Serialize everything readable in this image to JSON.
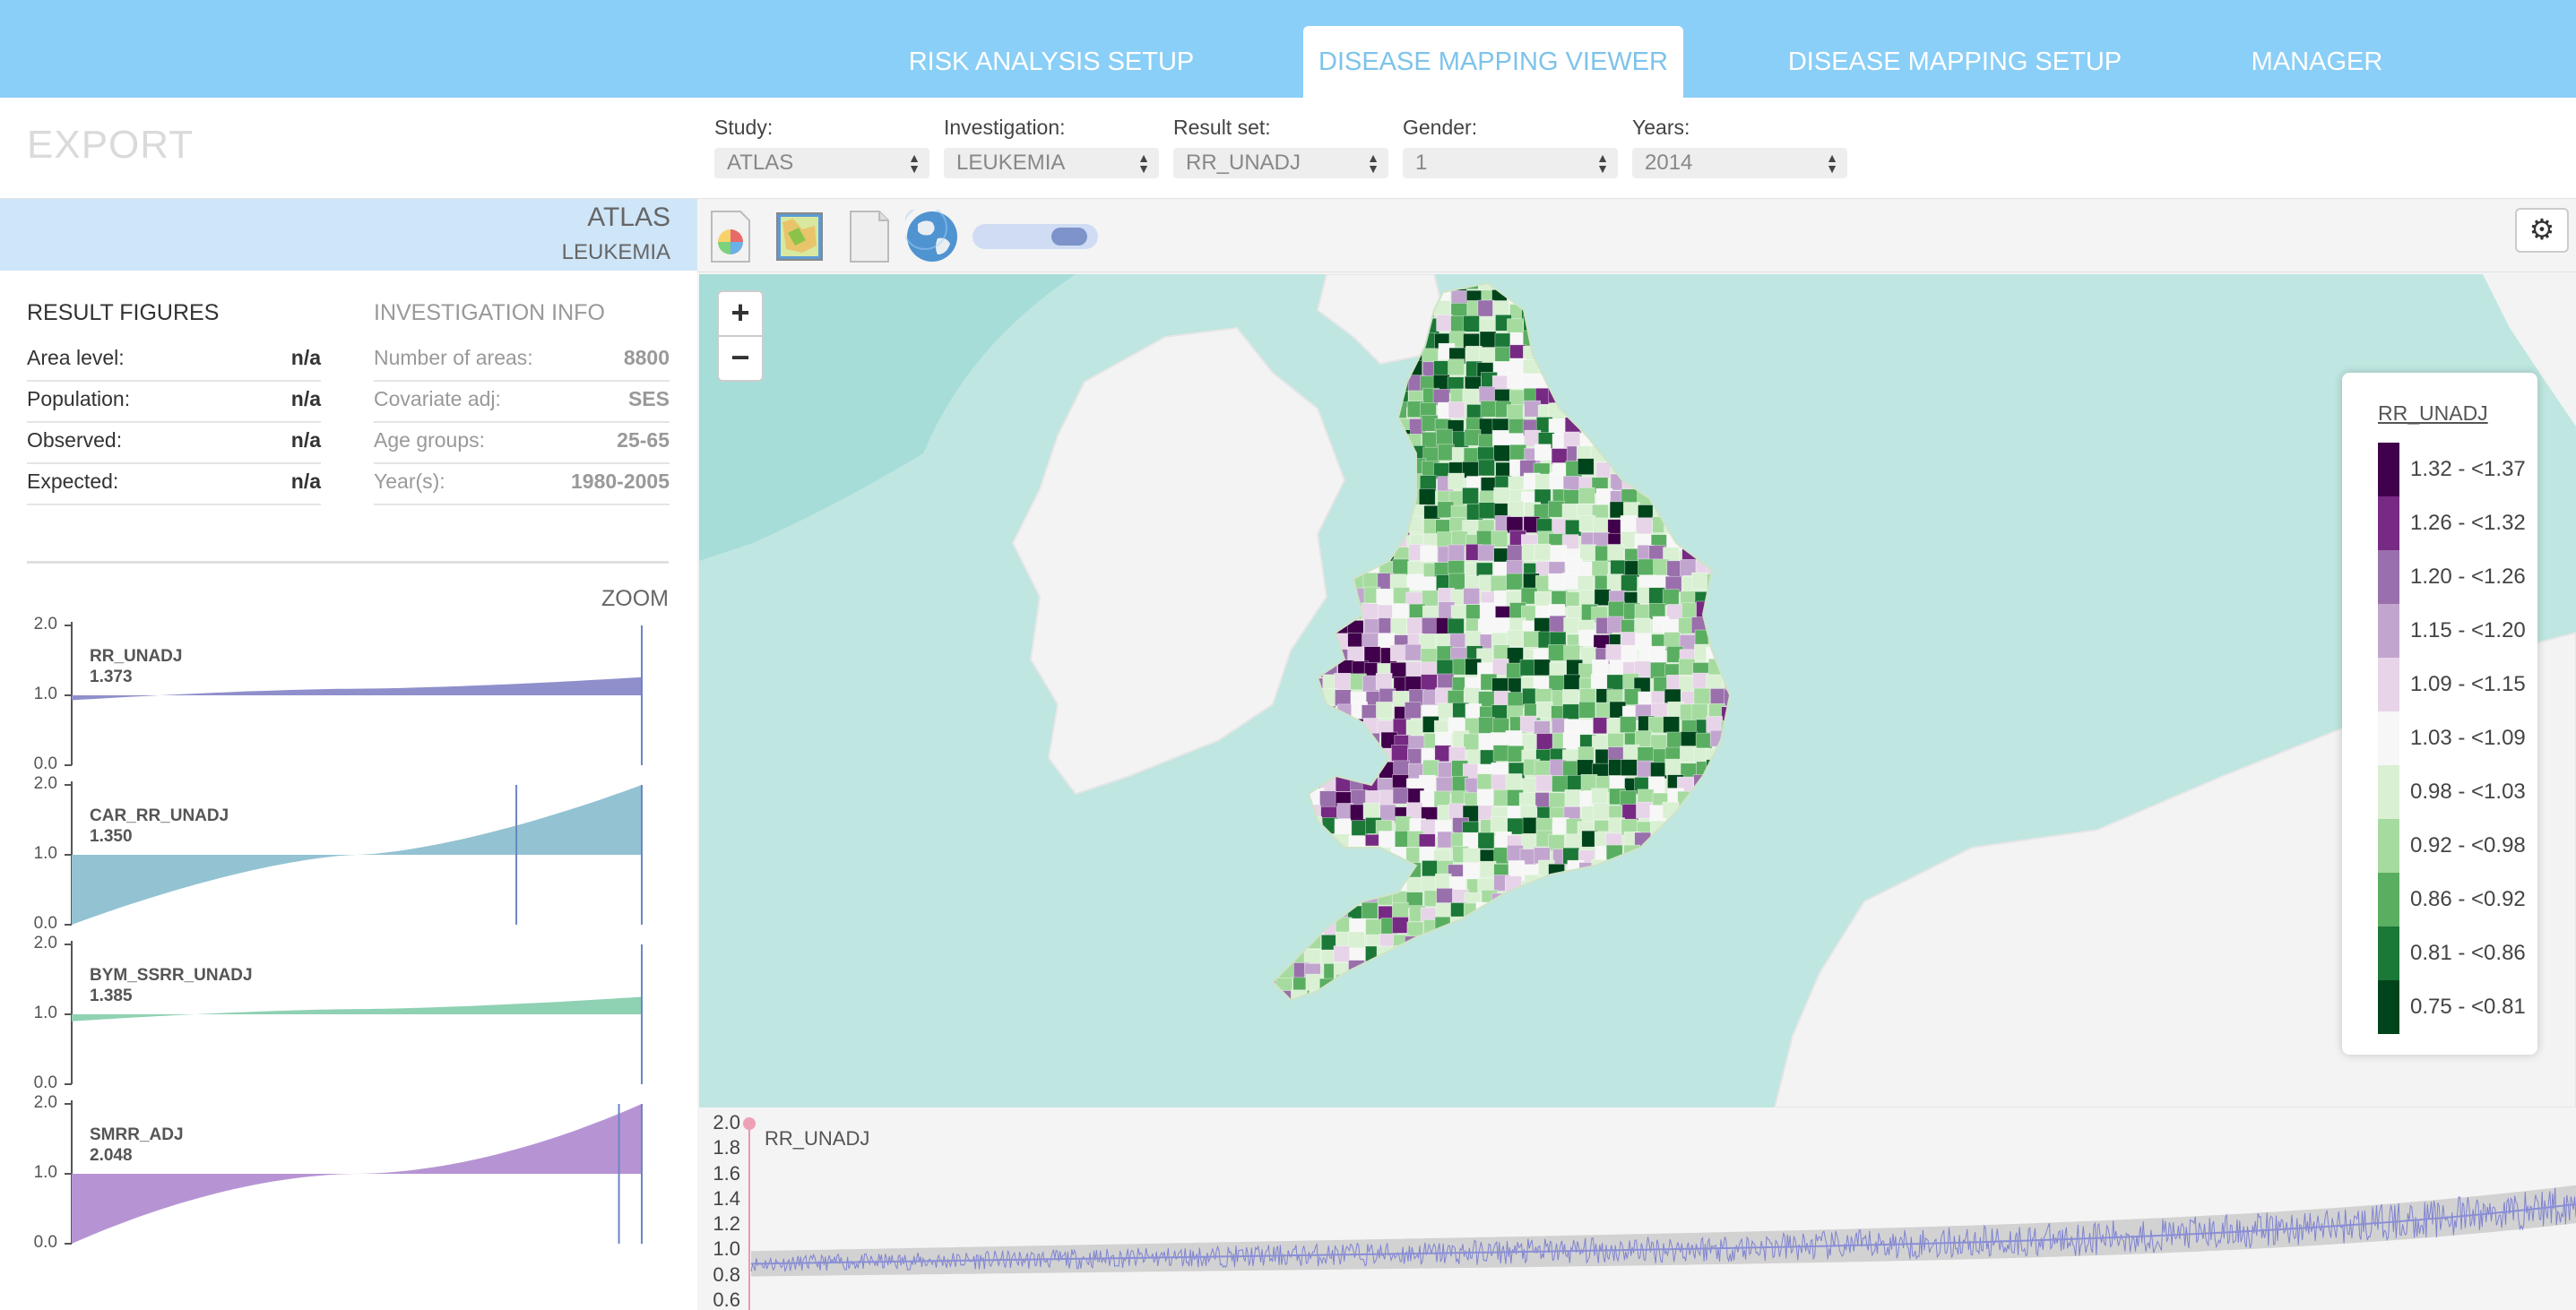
{
  "nav": {
    "tabs": [
      {
        "label": "RISK ANALYSIS SETUP",
        "active": false
      },
      {
        "label": "DISEASE MAPPING VIEWER",
        "active": true
      },
      {
        "label": "DISEASE MAPPING SETUP",
        "active": false
      },
      {
        "label": "MANAGER",
        "active": false
      }
    ]
  },
  "header": {
    "export_label": "EXPORT",
    "fields": [
      {
        "label": "Study:",
        "value": "ATLAS"
      },
      {
        "label": "Investigation:",
        "value": "LEUKEMIA"
      },
      {
        "label": "Result set:",
        "value": "RR_UNADJ"
      },
      {
        "label": "Gender:",
        "value": "1"
      },
      {
        "label": "Years:",
        "value": "2014"
      }
    ]
  },
  "banner": {
    "study": "ATLAS",
    "investigation": "LEUKEMIA"
  },
  "result_figures": {
    "title": "RESULT FIGURES",
    "rows": [
      {
        "key": "Area level:",
        "value": "n/a"
      },
      {
        "key": "Population:",
        "value": "n/a"
      },
      {
        "key": "Observed:",
        "value": "n/a"
      },
      {
        "key": "Expected:",
        "value": "n/a"
      }
    ]
  },
  "investigation_info": {
    "title": "INVESTIGATION INFO",
    "rows": [
      {
        "key": "Number of areas:",
        "value": "8800"
      },
      {
        "key": "Covariate adj:",
        "value": "SES"
      },
      {
        "key": "Age groups:",
        "value": "25-65"
      },
      {
        "key": "Year(s):",
        "value": "1980-2005"
      }
    ]
  },
  "zoom_label": "ZOOM",
  "distributions": {
    "axis_ticks": [
      "2.0",
      "1.0",
      "0.0"
    ],
    "panels": [
      {
        "name": "RR_UNADJ",
        "value": "1.373",
        "color": "#8f8fcc",
        "low": 0.93,
        "high": 1.26,
        "marker": 1.0
      },
      {
        "name": "CAR_RR_UNADJ",
        "value": "1.350",
        "color": "#93c2d2",
        "low": 0.0,
        "high": 2.0,
        "marker": 0.78
      },
      {
        "name": "BYM_SSRR_UNADJ",
        "value": "1.385",
        "color": "#8fd1b3",
        "low": 0.9,
        "high": 1.25,
        "marker": 1.0
      },
      {
        "name": "SMRR_ADJ",
        "value": "2.048",
        "color": "#b694d4",
        "low": 0.0,
        "high": 2.0,
        "marker": 0.96
      }
    ]
  },
  "toolbar": {
    "icons": [
      "chart-pie-icon",
      "map-icon",
      "document-icon",
      "globe-icon"
    ],
    "settings_glyph": "⚙"
  },
  "map": {
    "zoom_in": "+",
    "zoom_out": "−",
    "sea_color": "#bfe6e1",
    "land_color": "#f3f3f3"
  },
  "legend": {
    "title": "RR_UNADJ",
    "items": [
      {
        "label": "1.32 - <1.37",
        "color": "#40004b"
      },
      {
        "label": "1.26 - <1.32",
        "color": "#762a83"
      },
      {
        "label": "1.20 - <1.26",
        "color": "#9970ab"
      },
      {
        "label": "1.15 - <1.20",
        "color": "#c2a5cf"
      },
      {
        "label": "1.09 - <1.15",
        "color": "#e7d4e8"
      },
      {
        "label": "1.03 - <1.09",
        "color": "#f7f7f7"
      },
      {
        "label": "0.98 - <1.03",
        "color": "#d9f0d3"
      },
      {
        "label": "0.92 - <0.98",
        "color": "#a6dba0"
      },
      {
        "label": "0.86 - <0.92",
        "color": "#5aae61"
      },
      {
        "label": "0.81 - <0.86",
        "color": "#1b7837"
      },
      {
        "label": "0.75 - <0.81",
        "color": "#00441b"
      }
    ]
  },
  "timeseries": {
    "title": "RR_UNADJ",
    "ticks": [
      "2.0",
      "1.8",
      "1.6",
      "1.4",
      "1.2",
      "1.0",
      "0.8",
      "0.6"
    ]
  }
}
